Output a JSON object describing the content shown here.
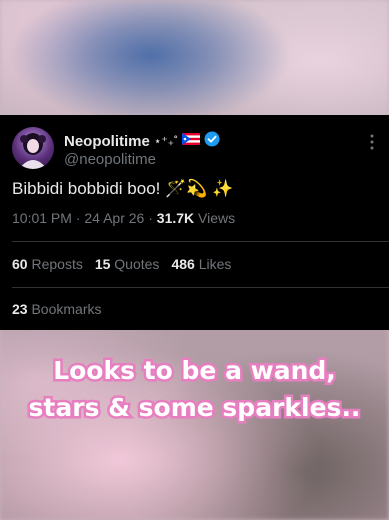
{
  "tweet": {
    "display_name": "Neopolitime",
    "name_decoration": "⋆⁺₊˚",
    "handle": "@neopolitime",
    "text": "Bibbidi bobbidi boo!",
    "emojis": "🪄💫 ✨",
    "time": "10:01 PM",
    "date": "24 Apr 26",
    "views_count": "31.7K",
    "views_label": "Views",
    "reposts_count": "60",
    "reposts_label": "Reposts",
    "quotes_count": "15",
    "quotes_label": "Quotes",
    "likes_count": "486",
    "likes_label": "Likes",
    "bookmarks_count": "23",
    "bookmarks_label": "Bookmarks"
  },
  "caption": {
    "line1": "Looks to be a wand,",
    "line2": "stars & some sparkles.."
  },
  "icons": {
    "verified": "verified-badge-icon",
    "flag": "puerto-rico-flag-icon",
    "more": "more-options-icon"
  },
  "colors": {
    "card_bg": "#000000",
    "primary_text": "#e7e9ea",
    "secondary_text": "#71767b",
    "verified_blue": "#1d9bf0",
    "caption_outline": "#e77fc0",
    "caption_fill": "#ffffff"
  }
}
